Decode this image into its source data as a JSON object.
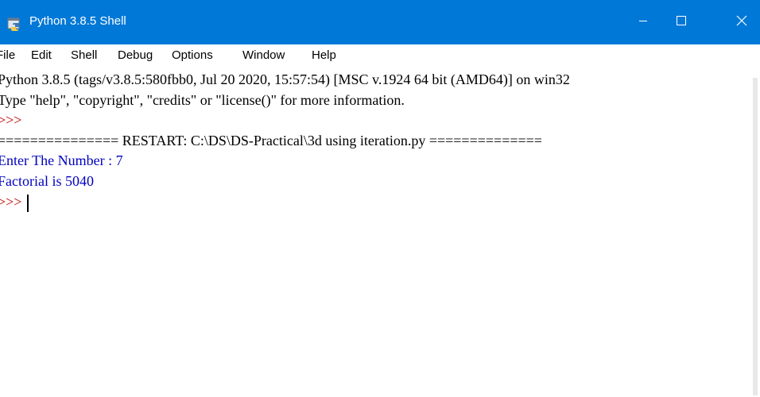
{
  "window": {
    "title": "Python 3.8.5 Shell",
    "titlebar_color": "#0078d7",
    "controls": {
      "minimize_icon": "minimize-icon",
      "maximize_icon": "maximize-icon",
      "close_icon": "close-icon"
    }
  },
  "menu": {
    "items": [
      {
        "label": "File"
      },
      {
        "label": "Edit"
      },
      {
        "label": "Shell"
      },
      {
        "label": "Debug"
      },
      {
        "label": "Options"
      },
      {
        "label": "Window"
      },
      {
        "label": "Help"
      }
    ]
  },
  "shell": {
    "colors": {
      "stdout": "#000000",
      "prompt": "#c00000",
      "user_output": "#0000c0"
    },
    "lines": [
      {
        "text": "Python 3.8.5 (tags/v3.8.5:580fbb0, Jul 20 2020, 15:57:54) [MSC v.1924 64 bit (AMD64)] on win32",
        "kind": "stdout"
      },
      {
        "text": "Type \"help\", \"copyright\", \"credits\" or \"license()\" for more information.",
        "kind": "stdout"
      },
      {
        "text": ">>> ",
        "kind": "prompt"
      },
      {
        "text": "=============== RESTART: C:\\DS\\DS-Practical\\3d using iteration.py ==============",
        "kind": "stdout"
      },
      {
        "text": "Enter The Number : 7",
        "kind": "user"
      },
      {
        "text": "Factorial is 5040",
        "kind": "user"
      },
      {
        "text": ">>> ",
        "kind": "prompt"
      }
    ]
  }
}
